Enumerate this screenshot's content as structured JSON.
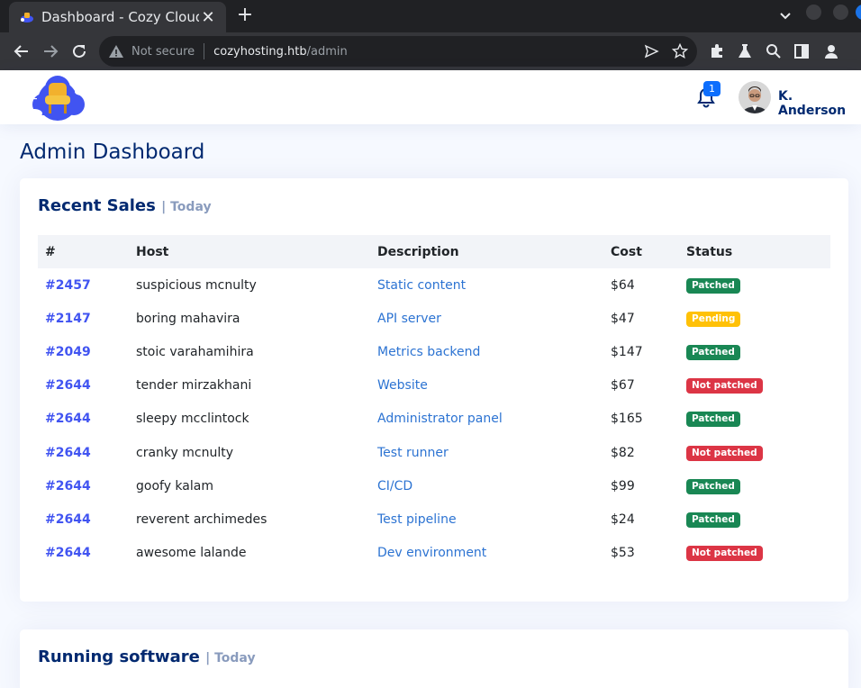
{
  "browser": {
    "tab_title": "Dashboard - Cozy Cloud",
    "close_glyph": "✕",
    "new_tab_glyph": "+",
    "not_secure": "Not secure",
    "url_host": "cozyhosting.htb",
    "url_path": "/admin"
  },
  "header": {
    "notification_count": "1",
    "user_name": "K. Anderson"
  },
  "page": {
    "title": "Admin Dashboard"
  },
  "recent_sales": {
    "title": "Recent Sales",
    "separator": "| Today",
    "columns": [
      "#",
      "Host",
      "Description",
      "Cost",
      "Status"
    ],
    "rows": [
      {
        "id": "#2457",
        "host": "suspicious mcnulty",
        "description": "Static content",
        "cost": "$64",
        "status": "Patched",
        "status_color": "#198754"
      },
      {
        "id": "#2147",
        "host": "boring mahavira",
        "description": "API server",
        "cost": "$47",
        "status": "Pending",
        "status_color": "#ffc107"
      },
      {
        "id": "#2049",
        "host": "stoic varahamihira",
        "description": "Metrics backend",
        "cost": "$147",
        "status": "Patched",
        "status_color": "#198754"
      },
      {
        "id": "#2644",
        "host": "tender mirzakhani",
        "description": "Website",
        "cost": "$67",
        "status": "Not patched",
        "status_color": "#dc3545"
      },
      {
        "id": "#2644",
        "host": "sleepy mcclintock",
        "description": "Administrator panel",
        "cost": "$165",
        "status": "Patched",
        "status_color": "#198754"
      },
      {
        "id": "#2644",
        "host": "cranky mcnulty",
        "description": "Test runner",
        "cost": "$82",
        "status": "Not patched",
        "status_color": "#dc3545"
      },
      {
        "id": "#2644",
        "host": "goofy kalam",
        "description": "CI/CD",
        "cost": "$99",
        "status": "Patched",
        "status_color": "#198754"
      },
      {
        "id": "#2644",
        "host": "reverent archimedes",
        "description": "Test pipeline",
        "cost": "$24",
        "status": "Patched",
        "status_color": "#198754"
      },
      {
        "id": "#2644",
        "host": "awesome lalande",
        "description": "Dev environment",
        "cost": "$53",
        "status": "Not patched",
        "status_color": "#dc3545"
      }
    ]
  },
  "running_software": {
    "title": "Running software",
    "separator": "| Today"
  },
  "icons": {
    "tab_favicon": "cozy-cloud-favicon",
    "back": "arrow-left-icon",
    "forward": "arrow-right-icon",
    "reload": "reload-icon",
    "warning": "warning-triangle-icon",
    "send": "send-icon",
    "bookmark": "star-icon",
    "extensions": "puzzle-icon",
    "labs": "flask-icon",
    "search": "search-icon",
    "side_panel": "side-panel-icon",
    "profile": "profile-icon",
    "notifications": "bell-icon"
  }
}
